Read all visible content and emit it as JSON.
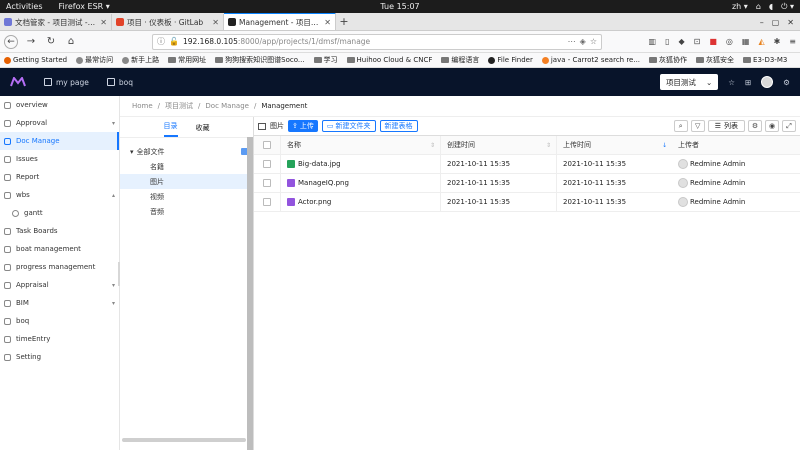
{
  "gnome": {
    "activities": "Activities",
    "app": "Firefox ESR",
    "clock": "Tue 15:07",
    "lang": "zh"
  },
  "browser": {
    "tabs": [
      {
        "label": "文档管家 - 项目测试 - Re",
        "active": false,
        "color": "#6f77d6"
      },
      {
        "label": "项目 · 仪表板 · GitLab",
        "active": false,
        "color": "#e24329"
      },
      {
        "label": "Management - 项目测试",
        "active": true,
        "color": "#222222"
      }
    ],
    "url_host": "192.168.0.105",
    "url_path": ":8000/app/projects/1/dmsf/manage",
    "bookmarks": [
      {
        "label": "Getting Started",
        "kind": "dot",
        "color": "#e66000"
      },
      {
        "label": "最常访问",
        "kind": "dot",
        "color": "#888888"
      },
      {
        "label": "新手上路",
        "kind": "dot",
        "color": "#888888"
      },
      {
        "label": "常用网址",
        "kind": "folder"
      },
      {
        "label": "狗狗搜索知识图谱Soco...",
        "kind": "folder"
      },
      {
        "label": "学习",
        "kind": "folder"
      },
      {
        "label": "Huihoo Cloud & CNCF",
        "kind": "folder"
      },
      {
        "label": "编程语言",
        "kind": "folder"
      },
      {
        "label": "File Finder",
        "kind": "dot",
        "color": "#222222"
      },
      {
        "label": "java - Carrot2 search re...",
        "kind": "dot",
        "color": "#f48024"
      },
      {
        "label": "灰狐协作",
        "kind": "folder"
      },
      {
        "label": "灰狐安全",
        "kind": "folder"
      },
      {
        "label": "E3-D3-M3",
        "kind": "folder"
      }
    ]
  },
  "app": {
    "nav": [
      "my page",
      "boq"
    ],
    "project": "项目测试"
  },
  "sidebar": [
    {
      "label": "overview",
      "chev": ""
    },
    {
      "label": "Approval",
      "chev": "▾"
    },
    {
      "label": "Doc Manage",
      "chev": "",
      "active": true
    },
    {
      "label": "Issues",
      "chev": ""
    },
    {
      "label": "Report",
      "chev": ""
    },
    {
      "label": "wbs",
      "chev": "▴"
    },
    {
      "label": "gantt",
      "chev": "",
      "sub": true
    },
    {
      "label": "Task Boards",
      "chev": ""
    },
    {
      "label": "boat management",
      "chev": ""
    },
    {
      "label": "progress management",
      "chev": ""
    },
    {
      "label": "Appraisal",
      "chev": "▾"
    },
    {
      "label": "BIM",
      "chev": "▾"
    },
    {
      "label": "boq",
      "chev": ""
    },
    {
      "label": "timeEntry",
      "chev": ""
    },
    {
      "label": "Setting",
      "chev": ""
    }
  ],
  "breadcrumb": [
    "Home",
    "项目测试",
    "Doc Manage",
    "Management"
  ],
  "tree": {
    "tabs": [
      "目录",
      "收藏"
    ],
    "root": "全部文件",
    "children": [
      "名籍",
      "图片",
      "视频",
      "音频"
    ],
    "selected": 1
  },
  "toolbar": {
    "label": "图片",
    "upload": "上传",
    "new_folder": "新建文件夹",
    "new_sheet": "新建表格",
    "view": "列表"
  },
  "table": {
    "headers": [
      "名称",
      "创建时间",
      "上传时间",
      "上传者"
    ],
    "rows": [
      {
        "name": "Big-data.jpg",
        "created": "2021-10-11 15:35",
        "uploaded": "2021-10-11 15:35",
        "uploader": "Redmine Admin",
        "icon_color": "#25a35a"
      },
      {
        "name": "ManageIQ.png",
        "created": "2021-10-11 15:35",
        "uploaded": "2021-10-11 15:35",
        "uploader": "Redmine Admin",
        "icon_color": "#9254de"
      },
      {
        "name": "Actor.png",
        "created": "2021-10-11 15:35",
        "uploaded": "2021-10-11 15:35",
        "uploader": "Redmine Admin",
        "icon_color": "#9254de"
      }
    ]
  }
}
